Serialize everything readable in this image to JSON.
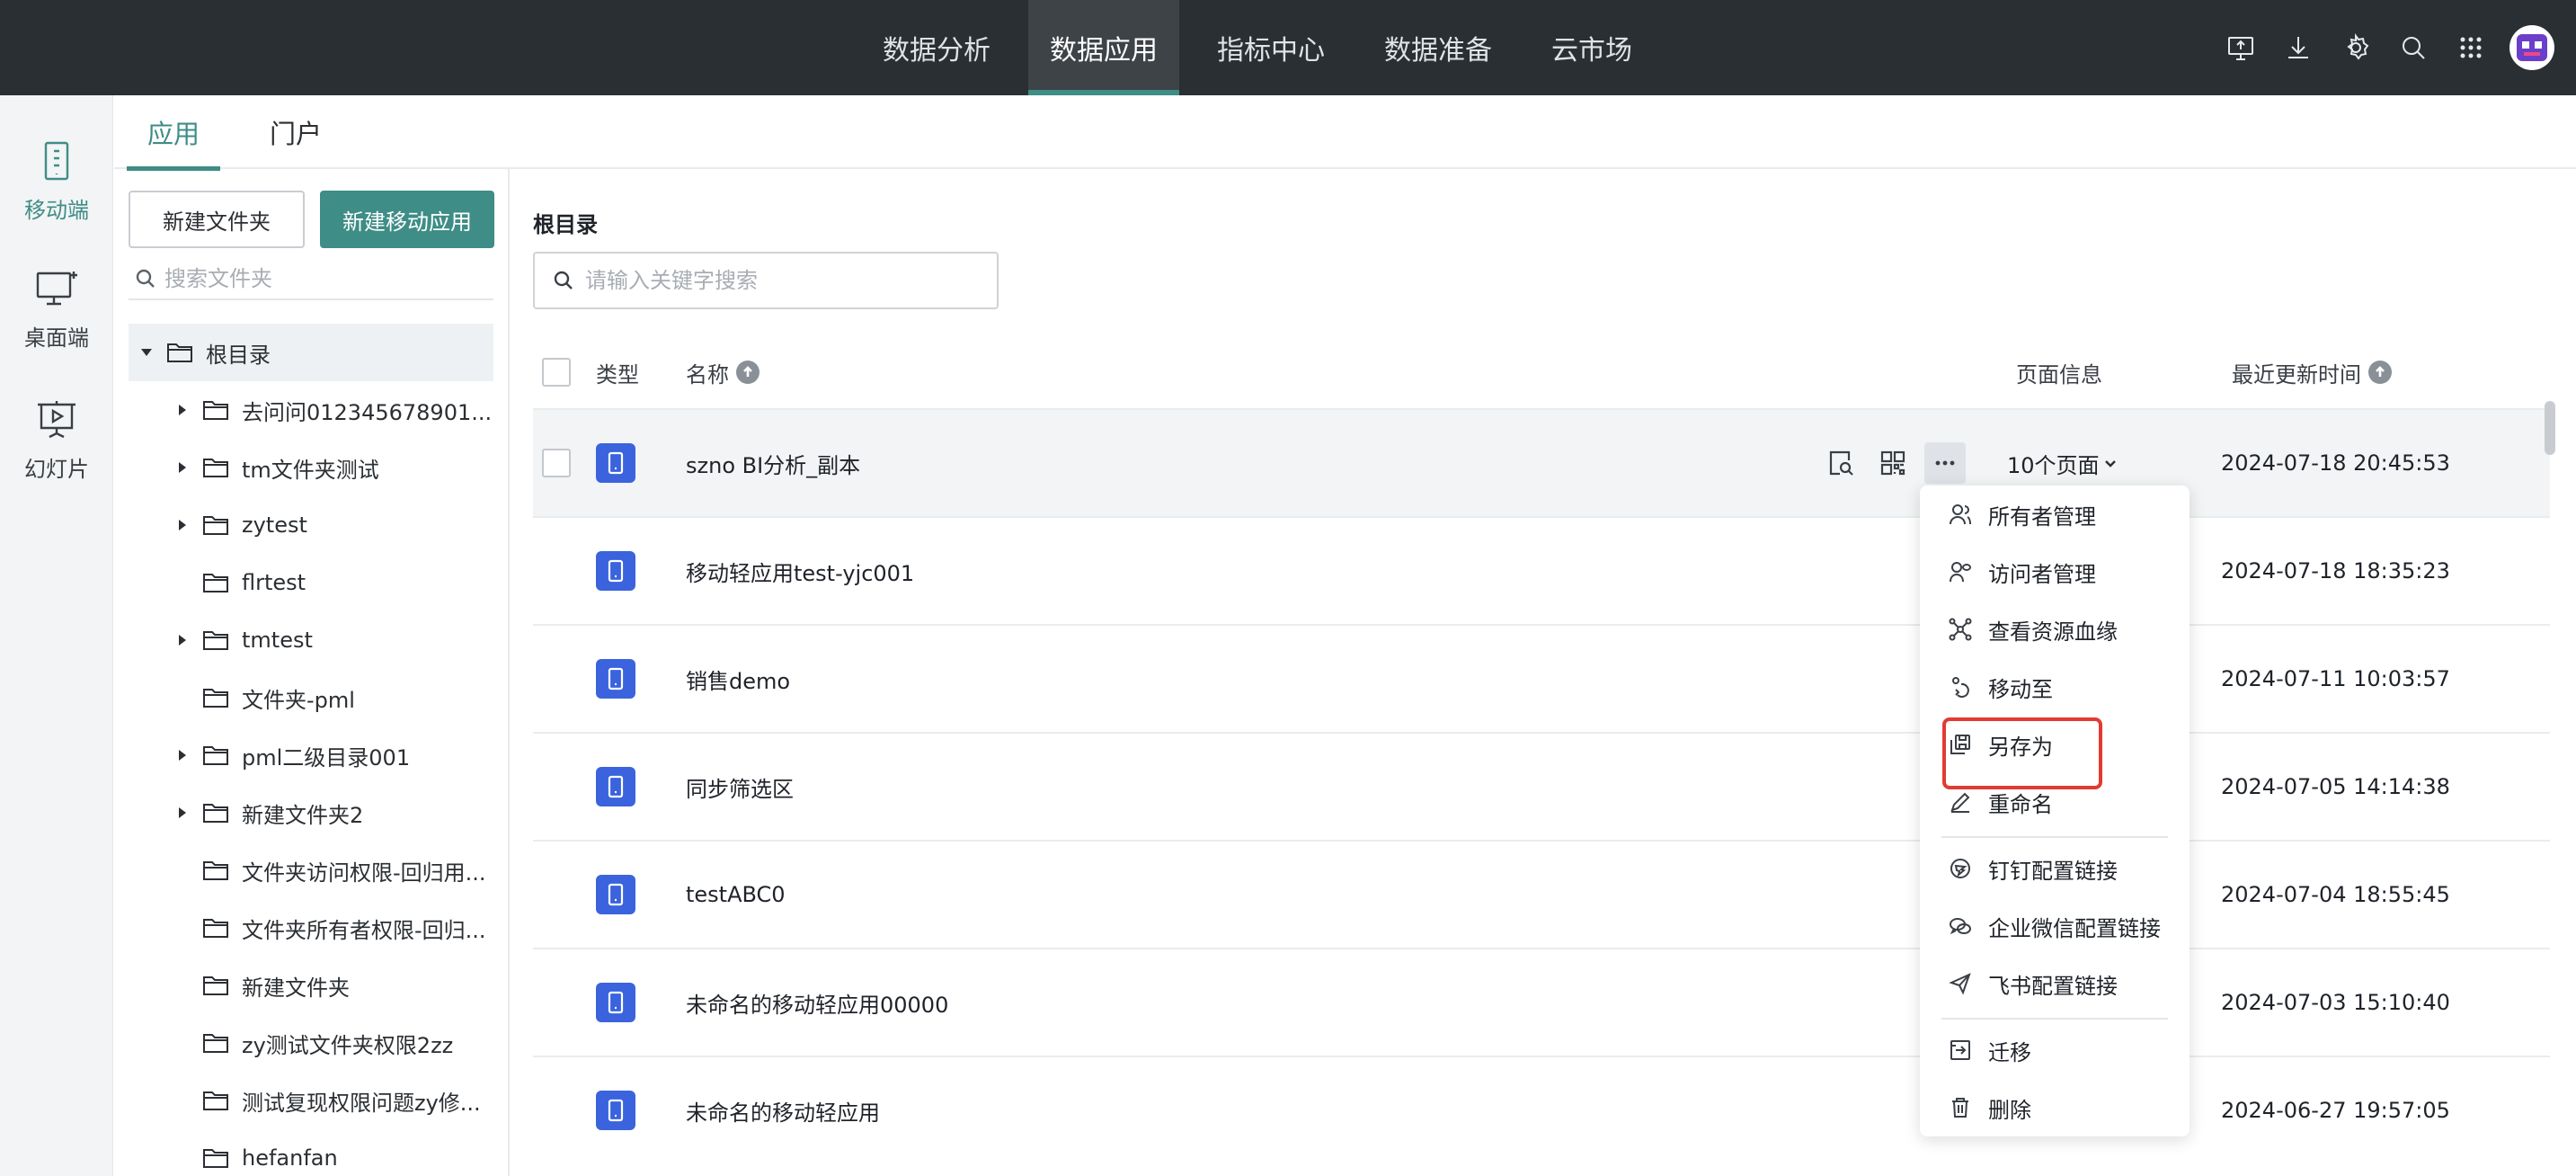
{
  "topnav": {
    "items": [
      {
        "label": "数据分析",
        "active": false
      },
      {
        "label": "数据应用",
        "active": true
      },
      {
        "label": "指标中心",
        "active": false
      },
      {
        "label": "数据准备",
        "active": false
      },
      {
        "label": "云市场",
        "active": false
      }
    ],
    "accent": "#3e8d86"
  },
  "sidebar": {
    "items": [
      {
        "label": "移动端",
        "icon": "mobile-icon",
        "active": true
      },
      {
        "label": "桌面端",
        "icon": "desktop-icon",
        "active": false
      },
      {
        "label": "幻灯片",
        "icon": "slides-icon",
        "active": false
      }
    ]
  },
  "subtabs": [
    {
      "label": "应用",
      "active": true
    },
    {
      "label": "门户",
      "active": false
    }
  ],
  "folder_panel": {
    "new_folder_label": "新建文件夹",
    "new_app_label": "新建移动应用",
    "search_placeholder": "搜索文件夹",
    "tree": [
      {
        "label": "根目录",
        "expanded": true,
        "root": true
      },
      {
        "label": "去问问012345678901...",
        "has_children": true
      },
      {
        "label": "tm文件夹测试",
        "has_children": true
      },
      {
        "label": "zytest",
        "has_children": true
      },
      {
        "label": "flrtest",
        "has_children": false
      },
      {
        "label": "tmtest",
        "has_children": true
      },
      {
        "label": "文件夹-pml",
        "has_children": false
      },
      {
        "label": "pml二级目录001",
        "has_children": true
      },
      {
        "label": "新建文件夹2",
        "has_children": true
      },
      {
        "label": "文件夹访问权限-回归用...",
        "has_children": false
      },
      {
        "label": "文件夹所有者权限-回归...",
        "has_children": false
      },
      {
        "label": "新建文件夹",
        "has_children": false
      },
      {
        "label": "zy测试文件夹权限2zz",
        "has_children": false
      },
      {
        "label": "测试复现权限问题zy修...",
        "has_children": false
      },
      {
        "label": "hefanfan",
        "has_children": false
      }
    ]
  },
  "main": {
    "breadcrumb": "根目录",
    "search_placeholder": "请输入关键字搜索",
    "columns": {
      "type": "类型",
      "name": "名称",
      "pages": "页面信息",
      "updated": "最近更新时间"
    },
    "rows": [
      {
        "name": "szno BI分析_副本",
        "pages": "10个页面",
        "updated": "2024-07-18 20:45:53",
        "hover": true
      },
      {
        "name": "移动轻应用test-yjc001",
        "pages": "",
        "updated": "2024-07-18 18:35:23"
      },
      {
        "name": "销售demo",
        "pages": "",
        "updated": "2024-07-11 10:03:57"
      },
      {
        "name": "同步筛选区",
        "pages": "",
        "updated": "2024-07-05 14:14:38"
      },
      {
        "name": "testABC0",
        "pages": "",
        "updated": "2024-07-04 18:55:45"
      },
      {
        "name": "未命名的移动轻应用00000",
        "pages": "",
        "updated": "2024-07-03 15:10:40"
      },
      {
        "name": "未命名的移动轻应用",
        "pages": "",
        "updated": "2024-06-27 19:57:05"
      }
    ]
  },
  "context_menu": {
    "items": [
      {
        "label": "所有者管理",
        "icon": "owner-icon"
      },
      {
        "label": "访问者管理",
        "icon": "visitor-icon"
      },
      {
        "label": "查看资源血缘",
        "icon": "lineage-icon"
      },
      {
        "label": "移动至",
        "icon": "move-icon"
      },
      {
        "label": "另存为",
        "icon": "save-as-icon",
        "highlighted": true
      },
      {
        "label": "重命名",
        "icon": "rename-icon"
      },
      {
        "label": "钉钉配置链接",
        "icon": "dingtalk-icon"
      },
      {
        "label": "企业微信配置链接",
        "icon": "wecom-icon"
      },
      {
        "label": "飞书配置链接",
        "icon": "feishu-icon"
      },
      {
        "label": "迁移",
        "icon": "migrate-icon"
      },
      {
        "label": "删除",
        "icon": "delete-icon"
      }
    ],
    "highlight_color": "#e23b32"
  }
}
